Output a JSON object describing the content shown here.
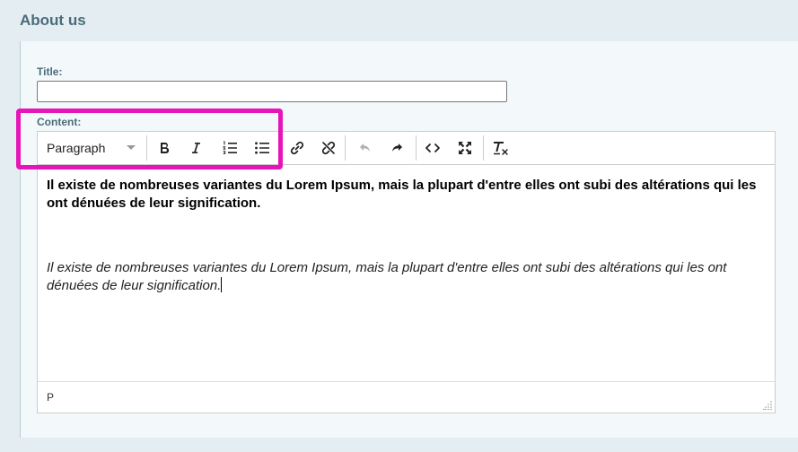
{
  "section": {
    "title": "About us"
  },
  "form": {
    "title_label": "Title:",
    "title_value": "",
    "content_label": "Content:"
  },
  "toolbar": {
    "format_select": "Paragraph",
    "buttons": [
      {
        "name": "bold",
        "icon": "bold-icon",
        "enabled": true
      },
      {
        "name": "italic",
        "icon": "italic-icon",
        "enabled": true
      },
      {
        "name": "numbered-list",
        "icon": "numbered-list-icon",
        "enabled": true
      },
      {
        "name": "bullet-list",
        "icon": "bullet-list-icon",
        "enabled": true
      },
      {
        "name": "link",
        "icon": "link-icon",
        "enabled": true
      },
      {
        "name": "unlink",
        "icon": "unlink-icon",
        "enabled": true
      },
      {
        "name": "undo",
        "icon": "undo-icon",
        "enabled": false
      },
      {
        "name": "redo",
        "icon": "redo-icon",
        "enabled": true
      },
      {
        "name": "source-code",
        "icon": "code-icon",
        "enabled": true
      },
      {
        "name": "fullscreen",
        "icon": "fullscreen-icon",
        "enabled": true
      },
      {
        "name": "clear-formatting",
        "icon": "clear-format-icon",
        "enabled": true
      }
    ]
  },
  "editor": {
    "paragraphs": [
      "Il existe de nombreuses variantes du Lorem Ipsum, mais la plupart d'entre elles ont subi des altérations qui les ont dénuées de leur signification.",
      "Il existe de nombreuses variantes du Lorem Ipsum, mais la plupart d'entre elles ont subi des altérations qui les ont dénuées de leur signification."
    ],
    "status_path": "P"
  },
  "colors": {
    "highlight": "#e515b8",
    "label": "#4a6b7a",
    "background": "#e4eef2"
  }
}
